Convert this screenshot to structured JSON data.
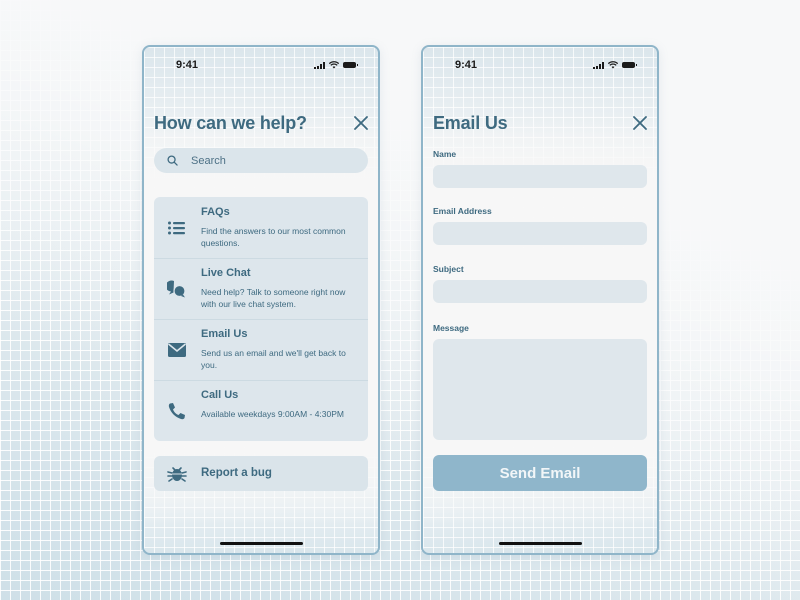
{
  "colors": {
    "accent": "#3e6a80",
    "phone_border": "#8fb5c9",
    "button": "#8fb6cb",
    "card": "#dde6ec"
  },
  "help_screen": {
    "status_time": "9:41",
    "title": "How can we help?",
    "close_icon": "close-icon",
    "search": {
      "placeholder": "Search",
      "icon": "search-icon"
    },
    "options": [
      {
        "icon": "list-icon",
        "title": "FAQs",
        "description": "Find the answers to our most common questions."
      },
      {
        "icon": "chat-bubbles-icon",
        "title": "Live Chat",
        "description": "Need help? Talk to someone right now with our live chat system."
      },
      {
        "icon": "envelope-icon",
        "title": "Email Us",
        "description": "Send us an email and we'll get back to you."
      },
      {
        "icon": "phone-icon",
        "title": "Call Us",
        "description": "Available weekdays 9:00AM - 4:30PM"
      }
    ],
    "report_bug": {
      "icon": "bug-icon",
      "label": "Report a bug"
    }
  },
  "email_screen": {
    "status_time": "9:41",
    "title": "Email Us",
    "close_icon": "close-icon",
    "fields": [
      {
        "label": "Name",
        "value": ""
      },
      {
        "label": "Email Address",
        "value": ""
      },
      {
        "label": "Subject",
        "value": ""
      },
      {
        "label": "Message",
        "value": ""
      }
    ],
    "send_button": "Send Email"
  }
}
